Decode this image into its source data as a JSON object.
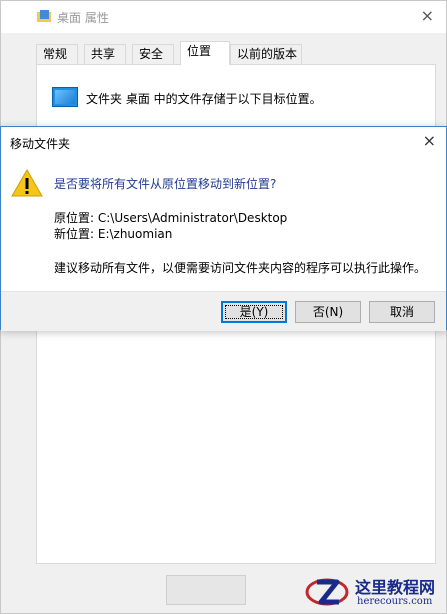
{
  "bg_window": {
    "title": "桌面 属性",
    "close_glyph": "×",
    "tabs": [
      "常规",
      "共享",
      "安全",
      "位置",
      "以前的版本"
    ],
    "active_tab": "位置",
    "location_text": "文件夹 桌面 中的文件存储于以下目标位置。"
  },
  "dialog": {
    "title": "移动文件夹",
    "close_glyph": "×",
    "question": "是否要将所有文件从原位置移动到新位置?",
    "original_location": "原位置: C:\\Users\\Administrator\\Desktop",
    "new_location": "新位置: E:\\zhuomian",
    "advice": "建议移动所有文件，以便需要访问文件夹内容的程序可以执行此操作。",
    "buttons": {
      "yes": "是(Y)",
      "no": "否(N)",
      "cancel": "取消"
    }
  },
  "watermark": {
    "name": "这里教程网",
    "url": "herecours.com"
  },
  "colors": {
    "dialog_border": "#3b83c4",
    "question_text": "#1f3a8f",
    "default_button_border": "#0078d7"
  }
}
